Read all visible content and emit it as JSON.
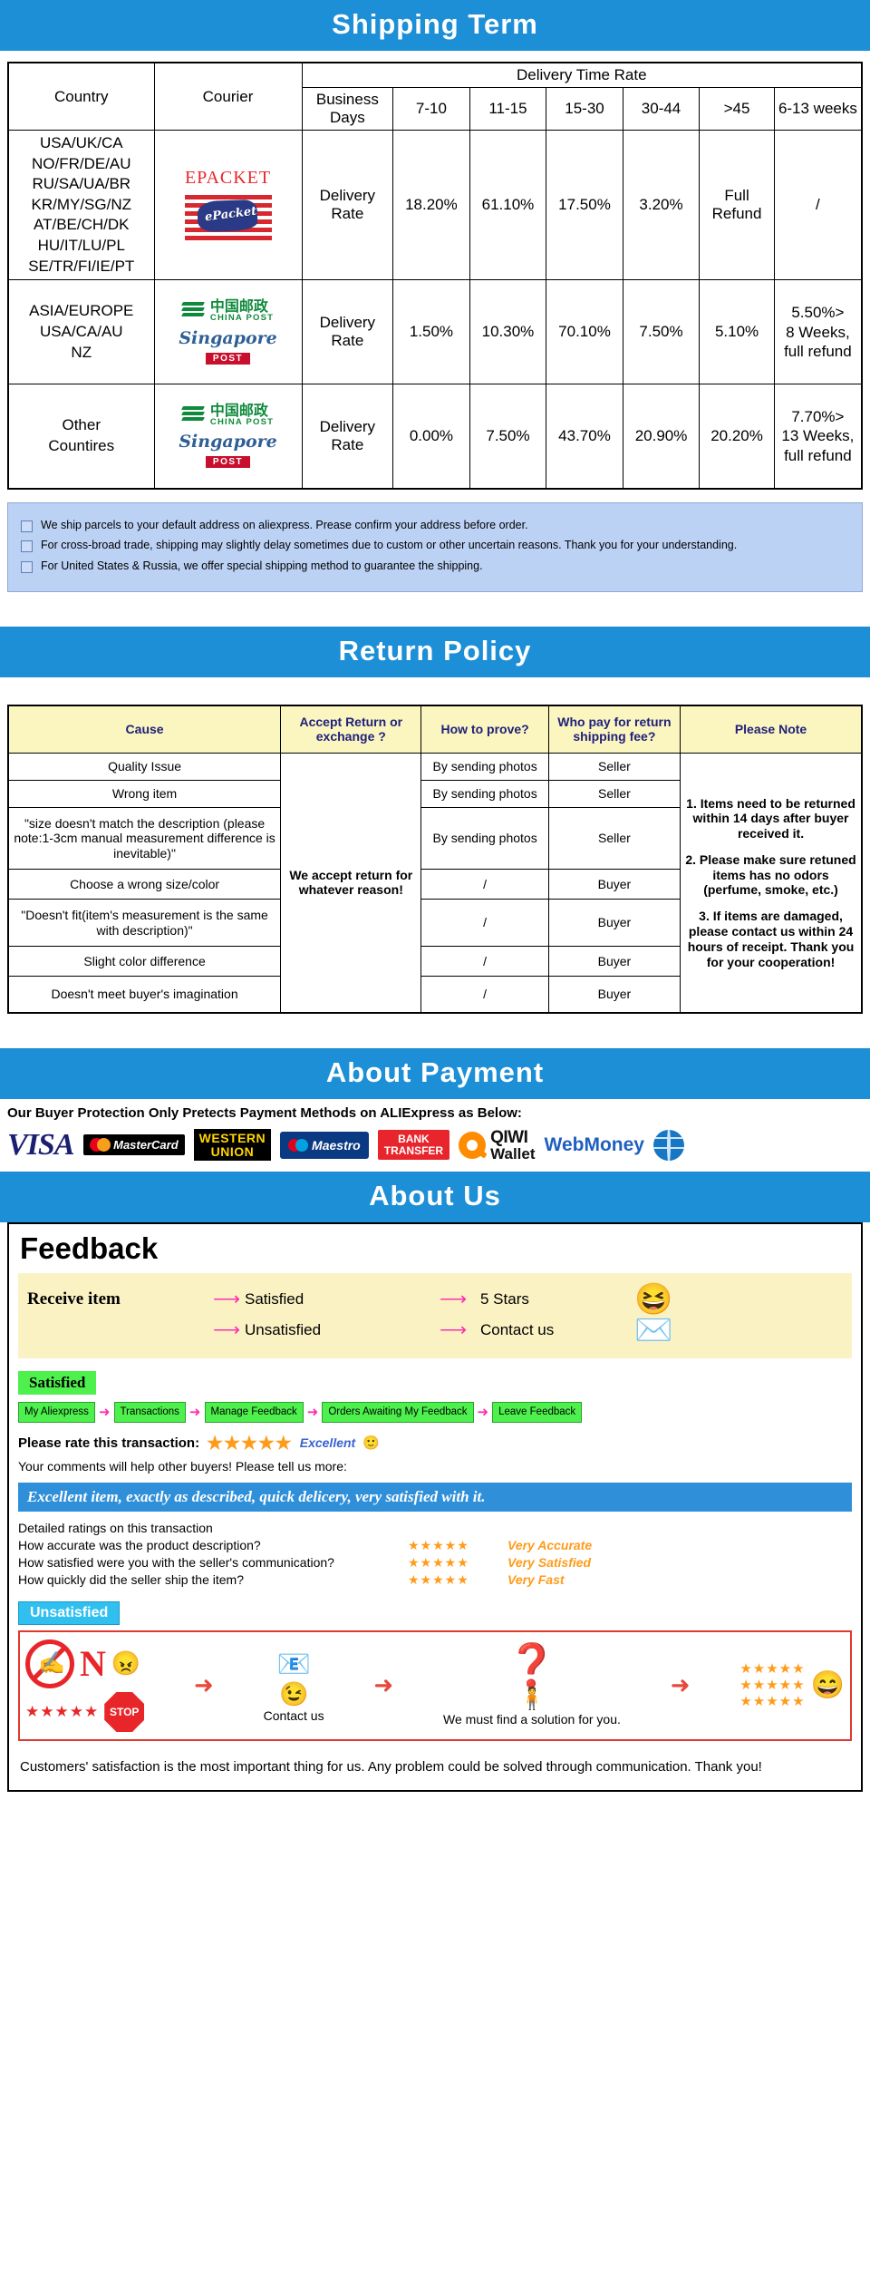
{
  "sections": {
    "shipping_title": "Shipping Term",
    "return_title": "Return Policy",
    "payment_title": "About Payment",
    "about_title": "About Us"
  },
  "shipping": {
    "headers": {
      "country": "Country",
      "courier": "Courier",
      "delivery_time_rate": "Delivery Time Rate",
      "business_days": "Business Days",
      "ranges": [
        "7-10",
        "11-15",
        "15-30",
        "30-44",
        ">45",
        "6-13 weeks"
      ]
    },
    "rows": [
      {
        "country": "USA/UK/CA\nNO/FR/DE/AU\nRU/SA/UA/BR\nKR/MY/SG/NZ\nAT/BE/CH/DK\nHU/IT/LU/PL\nSE/TR/FI/IE/PT",
        "courier_type": "epacket",
        "courier_label": "EPACKET",
        "courier_sub": "ePacket",
        "rate_label": "Delivery Rate",
        "values": [
          "18.20%",
          "61.10%",
          "17.50%",
          "3.20%",
          "Full Refund",
          "/"
        ]
      },
      {
        "country": "ASIA/EUROPE\nUSA/CA/AU\nNZ",
        "courier_type": "post",
        "courier_cn": "中国邮政",
        "courier_cn_en": "CHINA POST",
        "courier_sg": "Singapore",
        "courier_sg_badge": "POST",
        "rate_label": "Delivery Rate",
        "values": [
          "1.50%",
          "10.30%",
          "70.10%",
          "7.50%",
          "5.10%",
          "5.50%>\n8 Weeks,\nfull refund"
        ]
      },
      {
        "country": "Other\nCountires",
        "courier_type": "post",
        "courier_cn": "中国邮政",
        "courier_cn_en": "CHINA POST",
        "courier_sg": "Singapore",
        "courier_sg_badge": "POST",
        "rate_label": "Delivery Rate",
        "values": [
          "0.00%",
          "7.50%",
          "43.70%",
          "20.90%",
          "20.20%",
          "7.70%>\n13 Weeks,\nfull refund"
        ]
      }
    ],
    "notes": [
      "We ship parcels to your default address on aliexpress. Prease confirm your address before order.",
      "For cross-broad trade, shipping may slightly delay sometimes due to custom or other uncertain reasons. Thank you for your understanding.",
      "For United States & Russia, we offer special shipping method to guarantee the shipping."
    ]
  },
  "return_policy": {
    "headers": [
      "Cause",
      "Accept Return or exchange ?",
      "How to prove?",
      "Who pay for return shipping fee?",
      "Please Note"
    ],
    "accept_text": "We accept return for whatever reason!",
    "rows": [
      {
        "cause": "Quality Issue",
        "prove": "By sending photos",
        "who": "Seller"
      },
      {
        "cause": "Wrong item",
        "prove": "By sending photos",
        "who": "Seller"
      },
      {
        "cause": "\"size doesn't match the description (please note:1-3cm manual measurement difference is inevitable)\"",
        "prove": "By sending photos",
        "who": "Seller"
      },
      {
        "cause": "Choose a wrong size/color",
        "prove": "/",
        "who": "Buyer"
      },
      {
        "cause": "\"Doesn't fit(item's measurement is the same with description)\"",
        "prove": "/",
        "who": "Buyer"
      },
      {
        "cause": "Slight color difference",
        "prove": "/",
        "who": "Buyer"
      },
      {
        "cause": "Doesn't meet buyer's imagination",
        "prove": "/",
        "who": "Buyer"
      }
    ],
    "notes": [
      "1. Items need to be returned within 14 days after buyer received it.",
      "2. Please make sure retuned items has no odors (perfume, smoke, etc.)",
      "3. If items are damaged, please contact us within 24 hours of receipt. Thank you for your cooperation!"
    ]
  },
  "payment": {
    "intro": "Our Buyer Protection Only Pretects Payment Methods on ALIExpress as Below:",
    "methods": [
      {
        "name": "visa",
        "label": "VISA"
      },
      {
        "name": "mastercard",
        "label": "MasterCard"
      },
      {
        "name": "western-union",
        "label1": "WESTERN",
        "label2": "UNION"
      },
      {
        "name": "maestro",
        "label": "Maestro"
      },
      {
        "name": "bank-transfer",
        "label1": "BANK",
        "label2": "TRANSFER"
      },
      {
        "name": "qiwi",
        "label1": "QIWI",
        "label2": "Wallet"
      },
      {
        "name": "webmoney",
        "label": "WebMoney"
      }
    ]
  },
  "feedback": {
    "title": "Feedback",
    "receive": {
      "label": "Receive item",
      "satisfied": "Satisfied",
      "satisfied_result": "5 Stars",
      "unsatisfied": "Unsatisfied",
      "unsatisfied_result": "Contact us"
    },
    "satisfied_tag": "Satisfied",
    "steps": [
      "My Aliexpress",
      "Transactions",
      "Manage Feedback",
      "Orders Awaiting My Feedback",
      "Leave Feedback"
    ],
    "rate_label": "Please rate this transaction:",
    "rate_stars": "★★★★★",
    "rate_word": "Excellent",
    "comment_note": "Your comments will help other buyers! Please tell us more:",
    "quote": "Excellent item, exactly as described, quick delicery, very satisfied with it.",
    "detail_head": "Detailed ratings on this transaction",
    "detail_rows": [
      {
        "question": "How accurate was the product description?",
        "stars": "★★★★★",
        "value": "Very Accurate"
      },
      {
        "question": "How satisfied were you with the seller's communication?",
        "stars": "★★★★★",
        "value": "Very Satisfied"
      },
      {
        "question": "How quickly did the seller ship the item?",
        "stars": "★★★★★",
        "value": "Very Fast"
      }
    ],
    "unsatisfied_tag": "Unsatisfied",
    "unsat_contact": "Contact us",
    "unsat_solution": "We must find a solution for you.",
    "closing": "Customers' satisfaction is the most important thing for us. Any problem could be solved through communication. Thank you!"
  }
}
